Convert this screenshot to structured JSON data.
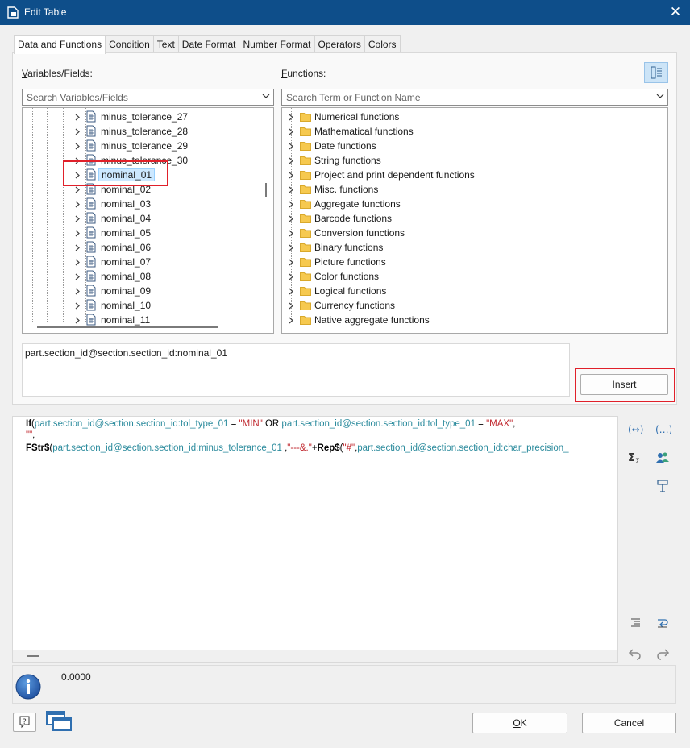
{
  "window": {
    "title": "Edit Table"
  },
  "tabs": [
    "Data and Functions",
    "Condition",
    "Text",
    "Date Format",
    "Number Format",
    "Operators",
    "Colors"
  ],
  "variables": {
    "label_prefix": "V",
    "label_rest": "ariables/Fields:",
    "search_placeholder": "Search Variables/Fields",
    "items": [
      "minus_tolerance_27",
      "minus_tolerance_28",
      "minus_tolerance_29",
      "minus_tolerance_30",
      "nominal_01",
      "nominal_02",
      "nominal_03",
      "nominal_04",
      "nominal_05",
      "nominal_06",
      "nominal_07",
      "nominal_08",
      "nominal_09",
      "nominal_10",
      "nominal_11"
    ],
    "selected": "nominal_01"
  },
  "functions": {
    "label_prefix": "F",
    "label_rest": "unctions:",
    "search_placeholder": "Search Term or Function Name",
    "items": [
      "Numerical functions",
      "Mathematical functions",
      "Date functions",
      "String functions",
      "Project and print dependent functions",
      "Misc. functions",
      "Aggregate functions",
      "Barcode functions",
      "Conversion functions",
      "Binary functions",
      "Picture functions",
      "Color functions",
      "Logical functions",
      "Currency functions",
      "Native aggregate functions"
    ]
  },
  "preview_text": "part.section_id@section.section_id:nominal_01",
  "insert_button": {
    "prefix": "I",
    "rest": "nsert"
  },
  "editor": {
    "line1": {
      "kw": "If",
      "p1": "(",
      "f1": "part.section_id@section.section_id:tol_type_01",
      "op1": " = ",
      "s1": "\"MIN\"",
      "op2": " OR ",
      "f2": "part.section_id@section.section_id:tol_type_01",
      "op3": " = ",
      "s2": "\"MAX\"",
      "end": ","
    },
    "line2": {
      "s": "\"\"",
      "end": ","
    },
    "line3": {
      "kw": "FStr$",
      "p1": "(",
      "f1": "part.section_id@section.section_id:minus_tolerance_01",
      "sep": " ,",
      "s1": "\"---&.\"",
      "op": "+",
      "kw2": "Rep$",
      "p2": "(",
      "s2": "\"#\"",
      "sep2": ",",
      "f2": "part.section_id@section.section_id:char_precision_"
    }
  },
  "status": {
    "value": "0.0000"
  },
  "buttons": {
    "ok_prefix": "O",
    "ok_rest": "K",
    "cancel": "Cancel"
  },
  "colors": {
    "titlebar": "#0e4e8a",
    "highlight": "#e0202a",
    "field": "#2a8a9c",
    "string": "#c0282f"
  }
}
